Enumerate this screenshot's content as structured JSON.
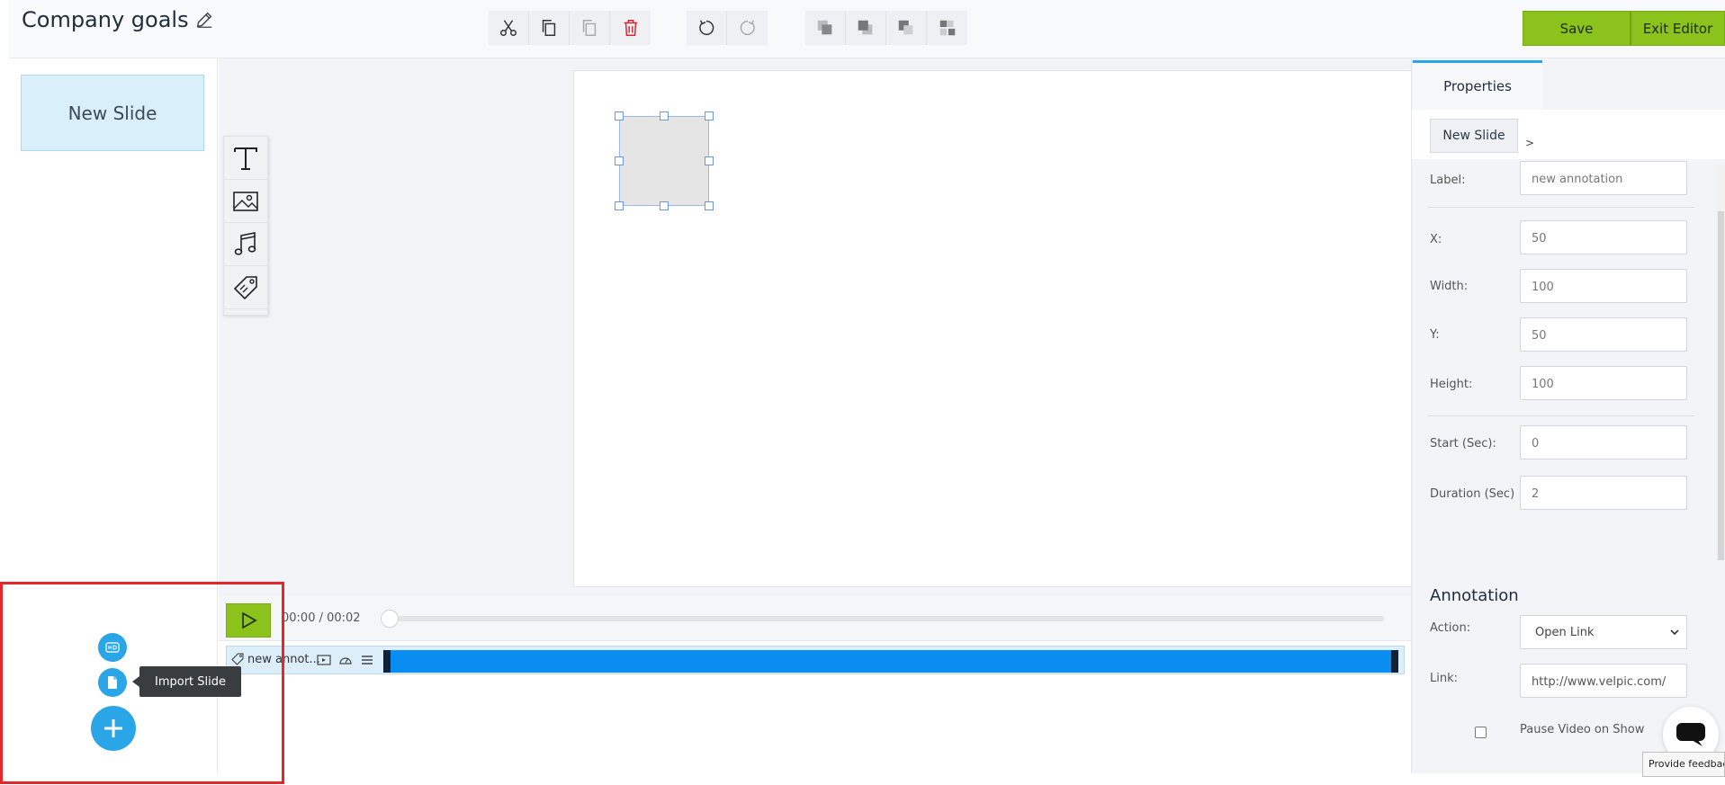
{
  "header": {
    "title": "Company goals",
    "save_label": "Save",
    "exit_label": "Exit Editor"
  },
  "toolbar": {
    "edit_group": [
      "scissors-icon",
      "copy-icon",
      "paste-icon",
      "trash-icon"
    ],
    "history_group": [
      "undo-icon",
      "redo-icon"
    ],
    "arrange_group": [
      "bring-forward-icon",
      "send-backward-icon",
      "bring-to-front-icon",
      "send-to-back-icon"
    ]
  },
  "slides": [
    {
      "label": "New Slide"
    }
  ],
  "tools": [
    "text-tool-icon",
    "image-tool-icon",
    "audio-tool-icon",
    "annotation-tool-icon"
  ],
  "timeline": {
    "time": "00:00 / 00:02",
    "layer_label": "new annot..."
  },
  "properties": {
    "tab_label": "Properties",
    "breadcrumb": "New Slide",
    "breadcrumb_sep": ">",
    "fields": [
      {
        "label": "Label:",
        "value": "new annotation"
      },
      {
        "label": "X:",
        "value": "50"
      },
      {
        "label": "Width:",
        "value": "100"
      },
      {
        "label": "Y:",
        "value": "50"
      },
      {
        "label": "Height:",
        "value": "100"
      },
      {
        "label": "Start (Sec):",
        "value": "0"
      },
      {
        "label": "Duration (Sec)",
        "value": "2"
      }
    ]
  },
  "annotation": {
    "title": "Annotation",
    "action_label": "Action:",
    "action_value": "Open Link",
    "link_label": "Link:",
    "link_value": "http://www.velpic.com/",
    "pause_label": "Pause Video on Show"
  },
  "floating": {
    "tooltip": "Import Slide"
  },
  "feedback_label": "Provide feedback",
  "colors": {
    "accent_green": "#8bc21b",
    "accent_blue": "#2aa6e8",
    "timeline_bar": "#0a8df0",
    "highlight_red": "#e5262b"
  }
}
